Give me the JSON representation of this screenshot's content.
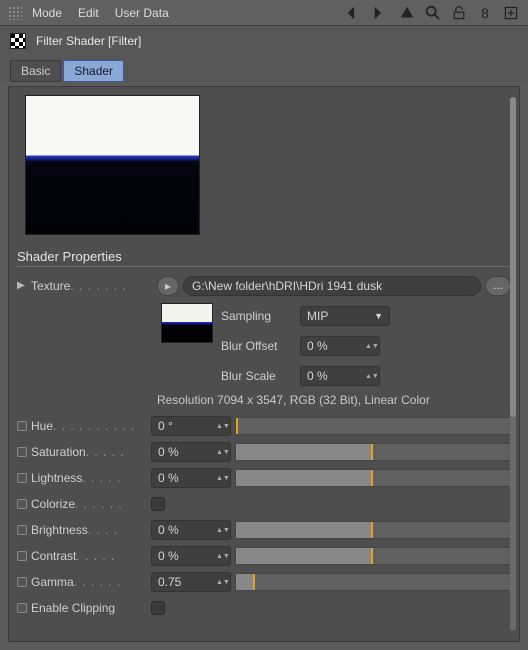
{
  "menubar": {
    "mode": "Mode",
    "edit": "Edit",
    "userdata": "User Data"
  },
  "title": "Filter Shader [Filter]",
  "tabs": {
    "basic": "Basic",
    "shader": "Shader"
  },
  "section": "Shader Properties",
  "texture": {
    "label": "Texture",
    "path": "G:\\New folder\\hDRI\\HDri 1941 dusk",
    "sampling_label": "Sampling",
    "sampling_value": "MIP",
    "blur_offset_label": "Blur Offset",
    "blur_offset_value": "0 %",
    "blur_scale_label": "Blur Scale",
    "blur_scale_value": "0 %"
  },
  "resolution": "Resolution 7094 x 3547, RGB (32 Bit), Linear Color",
  "params": {
    "hue": {
      "label": "Hue",
      "value": "0 °"
    },
    "saturation": {
      "label": "Saturation",
      "value": "0 %"
    },
    "lightness": {
      "label": "Lightness",
      "value": "0 %"
    },
    "colorize": {
      "label": "Colorize"
    },
    "brightness": {
      "label": "Brightness",
      "value": "0 %"
    },
    "contrast": {
      "label": "Contrast",
      "value": "0 %"
    },
    "gamma": {
      "label": "Gamma",
      "value": "0.75"
    },
    "enable_clipping": {
      "label": "Enable Clipping"
    }
  }
}
